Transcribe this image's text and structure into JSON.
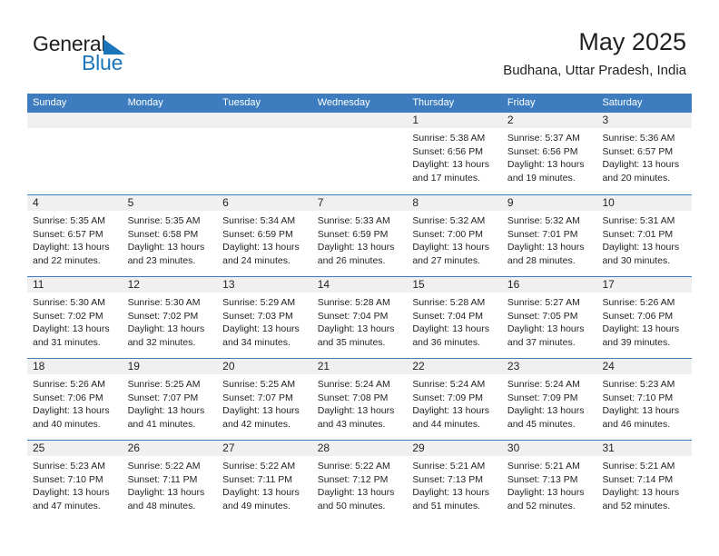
{
  "brand": {
    "name_part1": "General",
    "name_part2": "Blue",
    "flag_icon": "triangle-flag-icon",
    "accent_color": "#1b75bb"
  },
  "header": {
    "title": "May 2025",
    "subtitle": "Budhana, Uttar Pradesh, India"
  },
  "calendar": {
    "header_color": "#3d7dbf",
    "weekdays": [
      "Sunday",
      "Monday",
      "Tuesday",
      "Wednesday",
      "Thursday",
      "Friday",
      "Saturday"
    ],
    "weeks": [
      [
        {
          "day": "",
          "lines": []
        },
        {
          "day": "",
          "lines": []
        },
        {
          "day": "",
          "lines": []
        },
        {
          "day": "",
          "lines": []
        },
        {
          "day": "1",
          "lines": [
            "Sunrise: 5:38 AM",
            "Sunset: 6:56 PM",
            "Daylight: 13 hours",
            "and 17 minutes."
          ]
        },
        {
          "day": "2",
          "lines": [
            "Sunrise: 5:37 AM",
            "Sunset: 6:56 PM",
            "Daylight: 13 hours",
            "and 19 minutes."
          ]
        },
        {
          "day": "3",
          "lines": [
            "Sunrise: 5:36 AM",
            "Sunset: 6:57 PM",
            "Daylight: 13 hours",
            "and 20 minutes."
          ]
        }
      ],
      [
        {
          "day": "4",
          "lines": [
            "Sunrise: 5:35 AM",
            "Sunset: 6:57 PM",
            "Daylight: 13 hours",
            "and 22 minutes."
          ]
        },
        {
          "day": "5",
          "lines": [
            "Sunrise: 5:35 AM",
            "Sunset: 6:58 PM",
            "Daylight: 13 hours",
            "and 23 minutes."
          ]
        },
        {
          "day": "6",
          "lines": [
            "Sunrise: 5:34 AM",
            "Sunset: 6:59 PM",
            "Daylight: 13 hours",
            "and 24 minutes."
          ]
        },
        {
          "day": "7",
          "lines": [
            "Sunrise: 5:33 AM",
            "Sunset: 6:59 PM",
            "Daylight: 13 hours",
            "and 26 minutes."
          ]
        },
        {
          "day": "8",
          "lines": [
            "Sunrise: 5:32 AM",
            "Sunset: 7:00 PM",
            "Daylight: 13 hours",
            "and 27 minutes."
          ]
        },
        {
          "day": "9",
          "lines": [
            "Sunrise: 5:32 AM",
            "Sunset: 7:01 PM",
            "Daylight: 13 hours",
            "and 28 minutes."
          ]
        },
        {
          "day": "10",
          "lines": [
            "Sunrise: 5:31 AM",
            "Sunset: 7:01 PM",
            "Daylight: 13 hours",
            "and 30 minutes."
          ]
        }
      ],
      [
        {
          "day": "11",
          "lines": [
            "Sunrise: 5:30 AM",
            "Sunset: 7:02 PM",
            "Daylight: 13 hours",
            "and 31 minutes."
          ]
        },
        {
          "day": "12",
          "lines": [
            "Sunrise: 5:30 AM",
            "Sunset: 7:02 PM",
            "Daylight: 13 hours",
            "and 32 minutes."
          ]
        },
        {
          "day": "13",
          "lines": [
            "Sunrise: 5:29 AM",
            "Sunset: 7:03 PM",
            "Daylight: 13 hours",
            "and 34 minutes."
          ]
        },
        {
          "day": "14",
          "lines": [
            "Sunrise: 5:28 AM",
            "Sunset: 7:04 PM",
            "Daylight: 13 hours",
            "and 35 minutes."
          ]
        },
        {
          "day": "15",
          "lines": [
            "Sunrise: 5:28 AM",
            "Sunset: 7:04 PM",
            "Daylight: 13 hours",
            "and 36 minutes."
          ]
        },
        {
          "day": "16",
          "lines": [
            "Sunrise: 5:27 AM",
            "Sunset: 7:05 PM",
            "Daylight: 13 hours",
            "and 37 minutes."
          ]
        },
        {
          "day": "17",
          "lines": [
            "Sunrise: 5:26 AM",
            "Sunset: 7:06 PM",
            "Daylight: 13 hours",
            "and 39 minutes."
          ]
        }
      ],
      [
        {
          "day": "18",
          "lines": [
            "Sunrise: 5:26 AM",
            "Sunset: 7:06 PM",
            "Daylight: 13 hours",
            "and 40 minutes."
          ]
        },
        {
          "day": "19",
          "lines": [
            "Sunrise: 5:25 AM",
            "Sunset: 7:07 PM",
            "Daylight: 13 hours",
            "and 41 minutes."
          ]
        },
        {
          "day": "20",
          "lines": [
            "Sunrise: 5:25 AM",
            "Sunset: 7:07 PM",
            "Daylight: 13 hours",
            "and 42 minutes."
          ]
        },
        {
          "day": "21",
          "lines": [
            "Sunrise: 5:24 AM",
            "Sunset: 7:08 PM",
            "Daylight: 13 hours",
            "and 43 minutes."
          ]
        },
        {
          "day": "22",
          "lines": [
            "Sunrise: 5:24 AM",
            "Sunset: 7:09 PM",
            "Daylight: 13 hours",
            "and 44 minutes."
          ]
        },
        {
          "day": "23",
          "lines": [
            "Sunrise: 5:24 AM",
            "Sunset: 7:09 PM",
            "Daylight: 13 hours",
            "and 45 minutes."
          ]
        },
        {
          "day": "24",
          "lines": [
            "Sunrise: 5:23 AM",
            "Sunset: 7:10 PM",
            "Daylight: 13 hours",
            "and 46 minutes."
          ]
        }
      ],
      [
        {
          "day": "25",
          "lines": [
            "Sunrise: 5:23 AM",
            "Sunset: 7:10 PM",
            "Daylight: 13 hours",
            "and 47 minutes."
          ]
        },
        {
          "day": "26",
          "lines": [
            "Sunrise: 5:22 AM",
            "Sunset: 7:11 PM",
            "Daylight: 13 hours",
            "and 48 minutes."
          ]
        },
        {
          "day": "27",
          "lines": [
            "Sunrise: 5:22 AM",
            "Sunset: 7:11 PM",
            "Daylight: 13 hours",
            "and 49 minutes."
          ]
        },
        {
          "day": "28",
          "lines": [
            "Sunrise: 5:22 AM",
            "Sunset: 7:12 PM",
            "Daylight: 13 hours",
            "and 50 minutes."
          ]
        },
        {
          "day": "29",
          "lines": [
            "Sunrise: 5:21 AM",
            "Sunset: 7:13 PM",
            "Daylight: 13 hours",
            "and 51 minutes."
          ]
        },
        {
          "day": "30",
          "lines": [
            "Sunrise: 5:21 AM",
            "Sunset: 7:13 PM",
            "Daylight: 13 hours",
            "and 52 minutes."
          ]
        },
        {
          "day": "31",
          "lines": [
            "Sunrise: 5:21 AM",
            "Sunset: 7:14 PM",
            "Daylight: 13 hours",
            "and 52 minutes."
          ]
        }
      ]
    ]
  }
}
